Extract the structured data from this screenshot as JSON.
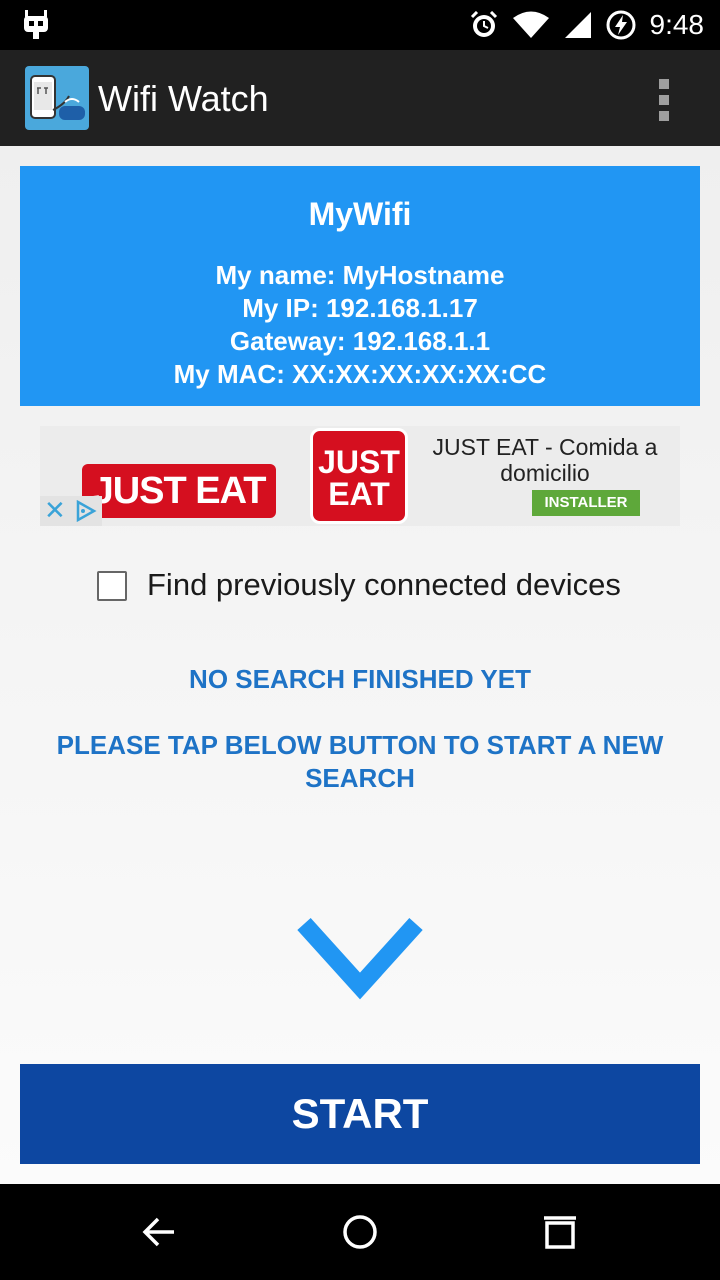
{
  "status_bar": {
    "time": "9:48",
    "icons": [
      "cyanogen-robot-icon",
      "alarm-icon",
      "wifi-signal-icon",
      "cell-signal-icon",
      "battery-charging-icon"
    ]
  },
  "app_bar": {
    "title": "Wifi Watch",
    "icon": "wifi-watch-app-icon",
    "overflow_icon": "more-vert-icon"
  },
  "network_card": {
    "ssid": "MyWifi",
    "name_line": "My name: MyHostname",
    "ip_line": "My IP: 192.168.1.17",
    "gateway_line": "Gateway: 192.168.1.1",
    "mac_line": "My MAC: XX:XX:XX:XX:XX:CC",
    "background_color": "#2196f3"
  },
  "ad": {
    "logo_wide_text": "JUST EAT",
    "logo_square_line1": "JUST",
    "logo_square_line2": "EAT",
    "title": "JUST EAT - Comida a domicilio",
    "install_label": "INSTALLER",
    "adchoices_icons": [
      "close-x-icon",
      "adchoices-icon"
    ]
  },
  "options": {
    "find_previous_label": "Find previously connected devices",
    "find_previous_checked": false
  },
  "search_status": {
    "line1": "NO SEARCH FINISHED YET",
    "line2": "PLEASE TAP BELOW BUTTON TO START A NEW SEARCH"
  },
  "start_button": {
    "label": "START",
    "color": "#0d47a1"
  },
  "nav_bar": {
    "icons": [
      "back-icon",
      "home-icon",
      "recents-icon"
    ]
  }
}
